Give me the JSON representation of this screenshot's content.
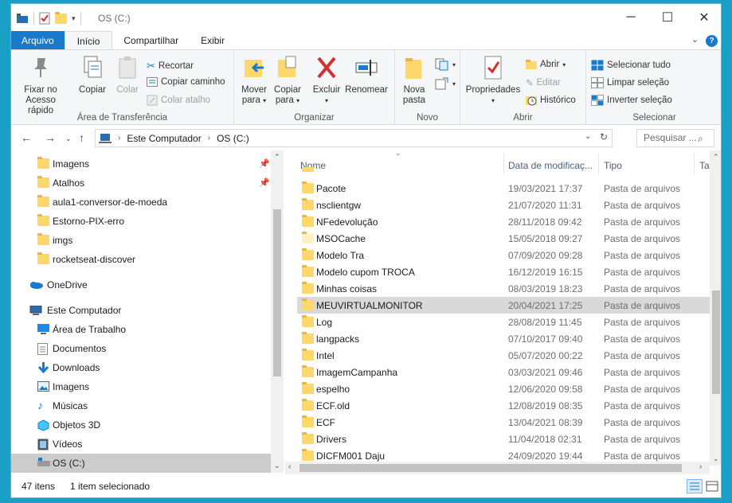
{
  "window": {
    "title": "OS (C:)"
  },
  "ribbon_tabs": [
    "Arquivo",
    "Início",
    "Compartilhar",
    "Exibir"
  ],
  "ribbon": {
    "clipboard": {
      "label": "Área de Transferência",
      "pin": "Fixar no\nAcesso rápido",
      "copy": "Copiar",
      "paste": "Colar",
      "cut": "Recortar",
      "copy_path": "Copiar caminho",
      "paste_shortcut": "Colar atalho"
    },
    "organize": {
      "label": "Organizar",
      "move_to": "Mover\npara",
      "copy_to": "Copiar\npara",
      "delete": "Excluir",
      "rename": "Renomear"
    },
    "new": {
      "label": "Novo",
      "new_folder": "Nova\npasta"
    },
    "open": {
      "label": "Abrir",
      "properties": "Propriedades",
      "open": "Abrir",
      "edit": "Editar",
      "history": "Histórico"
    },
    "select": {
      "label": "Selecionar",
      "select_all": "Selecionar tudo",
      "select_none": "Limpar seleção",
      "invert": "Inverter seleção"
    }
  },
  "address": {
    "path": [
      "Este Computador",
      "OS (C:)"
    ],
    "search_placeholder": "Pesquisar ..."
  },
  "nav_pane": {
    "quick_access": [
      {
        "label": "Imagens",
        "pinned": true
      },
      {
        "label": "Atalhos",
        "pinned": true
      },
      {
        "label": "aula1-conversor-de-moeda",
        "pinned": false
      },
      {
        "label": "Estorno-PIX-erro",
        "pinned": false
      },
      {
        "label": "imgs",
        "pinned": false
      },
      {
        "label": "rocketseat-discover",
        "pinned": false
      }
    ],
    "onedrive": "OneDrive",
    "this_pc": "Este Computador",
    "this_pc_items": [
      "Área de Trabalho",
      "Documentos",
      "Downloads",
      "Imagens",
      "Músicas",
      "Objetos 3D",
      "Vídeos",
      "OS (C:)"
    ]
  },
  "file_list": {
    "columns": [
      "Nome",
      "Data de modificaç...",
      "Tipo",
      "Ta"
    ],
    "rows": [
      {
        "name": "Pacote",
        "date": "19/03/2021 17:37",
        "type": "Pasta de arquivos"
      },
      {
        "name": "nsclientgw",
        "date": "21/07/2020 11:31",
        "type": "Pasta de arquivos"
      },
      {
        "name": "NFedevolução",
        "date": "28/11/2018 09:42",
        "type": "Pasta de arquivos"
      },
      {
        "name": "MSOCache",
        "date": "15/05/2018 09:27",
        "type": "Pasta de arquivos"
      },
      {
        "name": "Modelo Tra",
        "date": "07/09/2020 09:28",
        "type": "Pasta de arquivos"
      },
      {
        "name": "Modelo cupom TROCA",
        "date": "16/12/2019 16:15",
        "type": "Pasta de arquivos"
      },
      {
        "name": "Minhas coisas",
        "date": "08/03/2019 18:23",
        "type": "Pasta de arquivos"
      },
      {
        "name": "MEUVIRTUALMONITOR",
        "date": "20/04/2021 17:25",
        "type": "Pasta de arquivos"
      },
      {
        "name": "Log",
        "date": "28/08/2019 11:45",
        "type": "Pasta de arquivos"
      },
      {
        "name": "langpacks",
        "date": "07/10/2017 09:40",
        "type": "Pasta de arquivos"
      },
      {
        "name": "Intel",
        "date": "05/07/2020 00:22",
        "type": "Pasta de arquivos"
      },
      {
        "name": "ImagemCampanha",
        "date": "03/03/2021 09:46",
        "type": "Pasta de arquivos"
      },
      {
        "name": "espelho",
        "date": "12/06/2020 09:58",
        "type": "Pasta de arquivos"
      },
      {
        "name": "ECF.old",
        "date": "12/08/2019 08:35",
        "type": "Pasta de arquivos"
      },
      {
        "name": "ECF",
        "date": "13/04/2021 08:39",
        "type": "Pasta de arquivos"
      },
      {
        "name": "Drivers",
        "date": "11/04/2018 02:31",
        "type": "Pasta de arquivos"
      },
      {
        "name": "DICFM001 Daju",
        "date": "24/09/2020 19:44",
        "type": "Pasta de arquivos"
      }
    ]
  },
  "status": {
    "count": "47 itens",
    "selection": "1 item selecionado"
  },
  "colors": {
    "accent": "#1979ca",
    "folder": "#ffd86b",
    "selection": "#cccccc"
  }
}
